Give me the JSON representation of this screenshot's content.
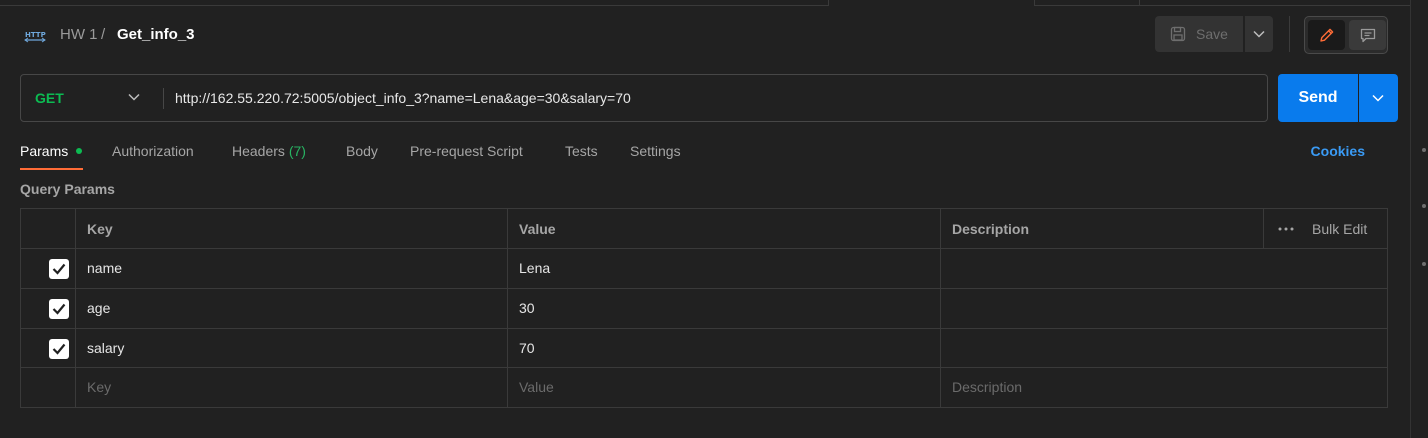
{
  "breadcrumb": {
    "parent": "HW 1",
    "separator": "/",
    "current": "Get_info_3"
  },
  "toolbar": {
    "save_label": "Save"
  },
  "request": {
    "method": "GET",
    "url": "http://162.55.220.72:5005/object_info_3?name=Lena&age=30&salary=70",
    "send_label": "Send"
  },
  "tabs": {
    "params": "Params",
    "authorization": "Authorization",
    "headers": "Headers",
    "headers_count": "(7)",
    "body": "Body",
    "pre_request": "Pre-request Script",
    "tests": "Tests",
    "settings": "Settings",
    "cookies": "Cookies"
  },
  "query_params": {
    "title": "Query Params",
    "columns": {
      "key": "Key",
      "value": "Value",
      "description": "Description",
      "bulk_edit": "Bulk Edit"
    },
    "rows": [
      {
        "checked": true,
        "key": "name",
        "value": "Lena",
        "description": ""
      },
      {
        "checked": true,
        "key": "age",
        "value": "30",
        "description": ""
      },
      {
        "checked": true,
        "key": "salary",
        "value": "70",
        "description": ""
      }
    ],
    "placeholders": {
      "key": "Key",
      "value": "Value",
      "description": "Description"
    }
  },
  "colors": {
    "background": "#212121",
    "method_get": "#0cbb52",
    "send_button": "#097bed",
    "active_tab_underline": "#ff6c37",
    "cookies_link": "#3a9bf5"
  },
  "icons": [
    "http-icon",
    "save-icon",
    "chevron-down-icon",
    "pencil-icon",
    "comment-icon",
    "checkmark-icon",
    "more-horizontal-icon"
  ]
}
